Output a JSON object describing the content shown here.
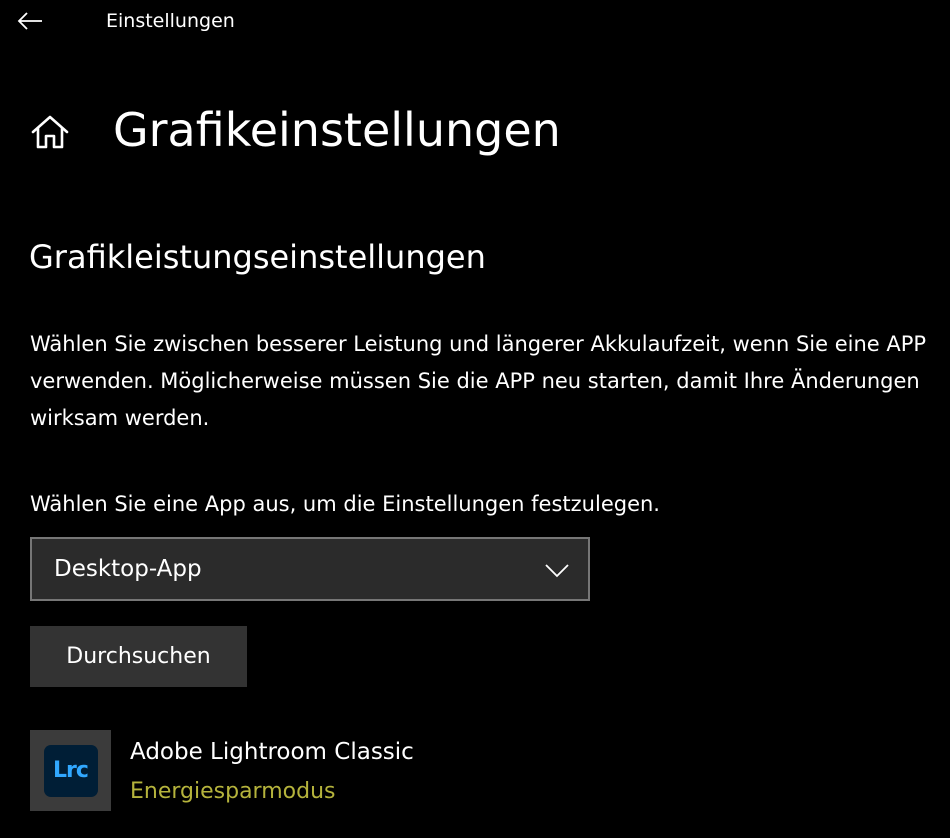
{
  "window": {
    "title": "Einstellungen",
    "back_icon": "back-arrow-icon"
  },
  "header": {
    "home_icon": "home-icon",
    "page_title": "Grafikeinstellungen"
  },
  "main": {
    "section_title": "Grafikleistungseinstellungen",
    "description": "Wählen Sie zwischen besserer Leistung und längerer Akkulaufzeit, wenn Sie eine APP verwenden. Möglicherweise müssen Sie die APP neu starten, damit Ihre Änderungen wirksam werden.",
    "select_label": "Wählen Sie eine App aus, um die Einstellungen festzulegen.",
    "app_type_select": {
      "value": "Desktop-App",
      "icon": "chevron-down-icon"
    },
    "browse_button_label": "Durchsuchen",
    "apps": [
      {
        "name": "Adobe Lightroom Classic",
        "mode": "Energiesparmodus",
        "icon_text": "Lrc"
      }
    ]
  },
  "colors": {
    "background": "#000000",
    "text": "#ffffff",
    "select_background": "#2b2b2b",
    "select_border": "#767676",
    "button_background": "#333333",
    "mode_accent": "#b5b33c",
    "lightroom_icon_bg": "#001e36",
    "lightroom_icon_text": "#31a8ff"
  }
}
